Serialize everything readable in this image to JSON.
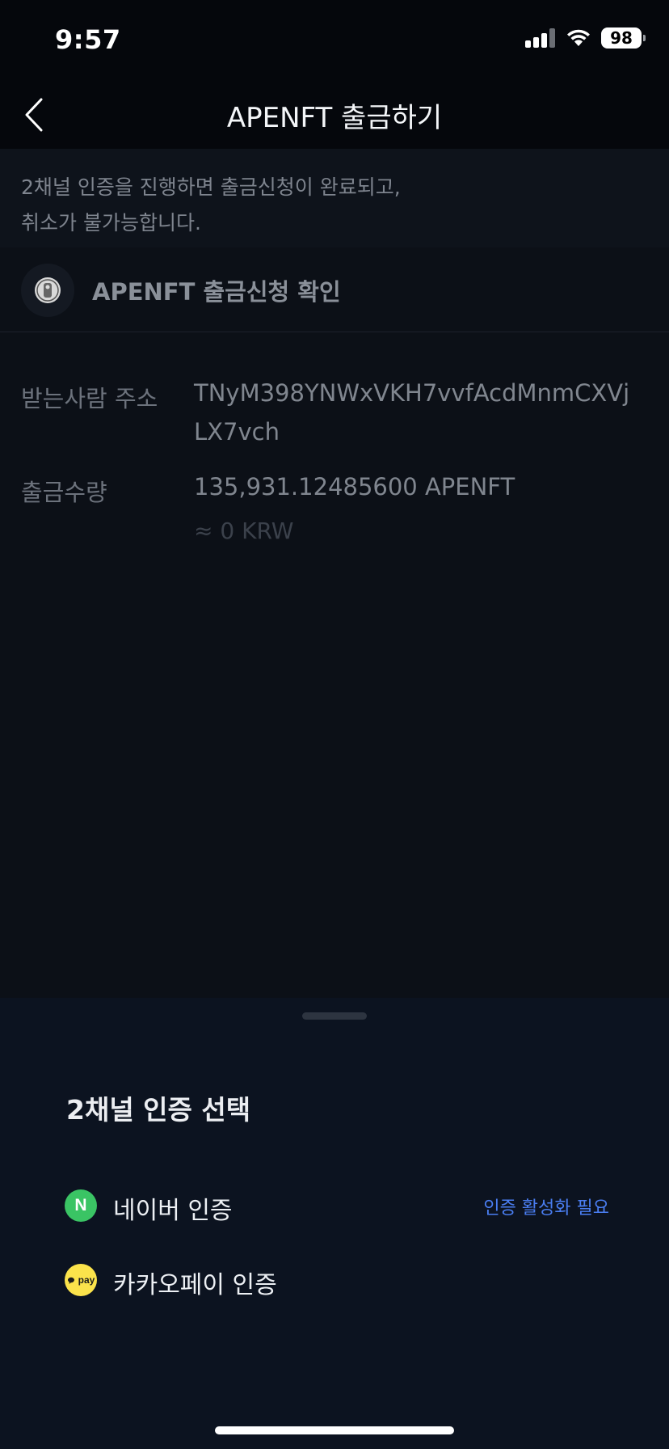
{
  "status_bar": {
    "time": "9:57",
    "battery": "98",
    "icons": [
      "signal-icon",
      "wifi-icon",
      "battery-icon"
    ]
  },
  "header": {
    "title": "APENFT 출금하기",
    "back_icon": "chevron-left-icon"
  },
  "notice": {
    "line1": "2채널 인증을 진행하면 출금신청이 완료되고,",
    "line2": "취소가 불가능합니다."
  },
  "confirm": {
    "title": "APENFT 출금신청 확인",
    "logo_icon": "apenft-coin-logo"
  },
  "details": {
    "address_label": "받는사람 주소",
    "address_line1": "TNyM398YNWxVKH7vvfAcdMnmCXVj",
    "address_line2": "LX7vch",
    "amount_label": "출금수량",
    "amount_value": "135,931.12485600 APENFT",
    "amount_krw": "≈ 0 KRW"
  },
  "sheet": {
    "title": "2채널 인증 선택",
    "options": [
      {
        "label": "네이버 인증",
        "icon": "naver-icon",
        "icon_text": "N",
        "status": "인증 활성화 필요"
      },
      {
        "label": "카카오페이 인증",
        "icon": "kakaopay-icon",
        "icon_text": "pay",
        "status": ""
      }
    ]
  },
  "colors": {
    "background": "#05070c",
    "sheet": "#0c1320",
    "accent_link": "#4a7ef2",
    "naver_green": "#3ac464",
    "kakao_yellow": "#fbe34b"
  }
}
